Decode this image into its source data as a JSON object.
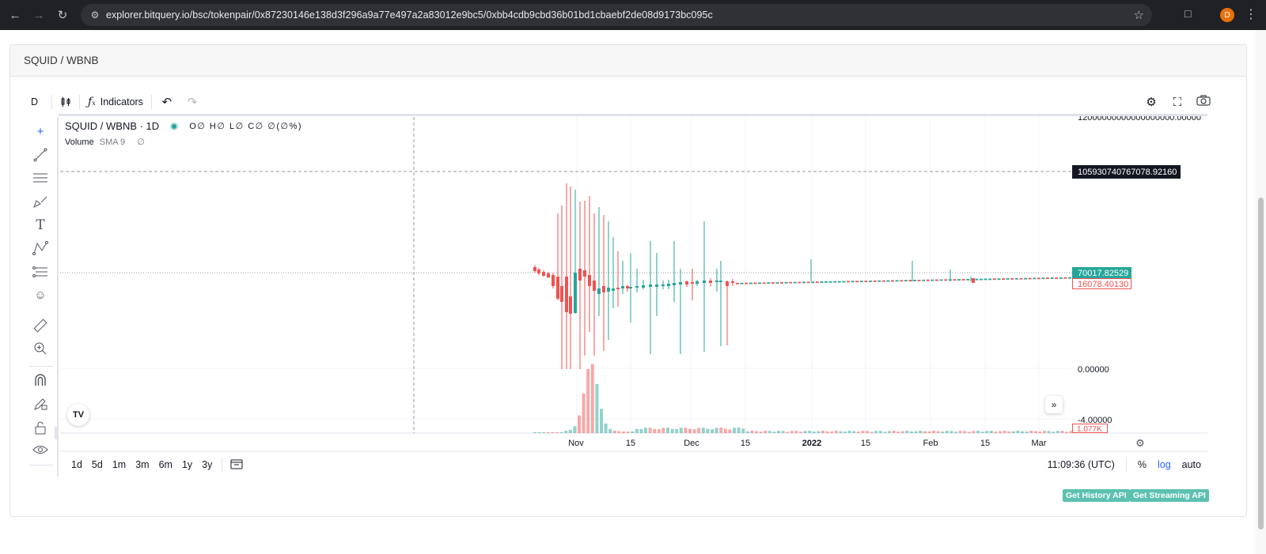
{
  "browser": {
    "url": "explorer.bitquery.io/bsc/tokenpair/0x87230146e138d3f296a9a77e497a2a83012e9bc5/0xbb4cdb9cbd36b01bd1cbaebf2de08d9173bc095c",
    "avatar_letter": "D"
  },
  "card": {
    "title": "SQUID / WBNB"
  },
  "toolbar": {
    "interval": "D",
    "indicators_label": "Indicators"
  },
  "legend": {
    "symbol": "SQUID / WBNB · 1D",
    "ohlc": "O∅ H∅ L∅ C∅ ∅(∅%)",
    "volume_label": "Volume",
    "volume_sma": "SMA 9",
    "volume_value": "∅"
  },
  "price_axis": {
    "top_label": "12000000000000000000.00000",
    "crosshair_label": "105930740767078.92160",
    "last_price_label": "70017.82529",
    "prev_price_label": "16078.40130",
    "zero_label": "0.00000",
    "neg_label": "-4.00000",
    "volume_label": "1.077K"
  },
  "time_axis": {
    "ticks": [
      "Nov",
      "15",
      "Dec",
      "15",
      "2022",
      "15",
      "Feb",
      "15",
      "Mar"
    ]
  },
  "range_buttons": [
    "1d",
    "5d",
    "1m",
    "3m",
    "6m",
    "1y",
    "3y"
  ],
  "bottom_right": {
    "time": "11:09:36 (UTC)",
    "percent": "%",
    "log": "log",
    "auto": "auto"
  },
  "api_buttons": {
    "history": "Get History API",
    "streaming": "Get Streaming API"
  },
  "colors": {
    "up": "#26a69a",
    "down": "#ef5350",
    "accent": "#2962ff",
    "api_button": "#5cc1b1"
  },
  "chart_data": {
    "type": "candlestick",
    "symbol": "SQUID / WBNB",
    "interval": "1D",
    "scale": "log",
    "x_ticks": [
      "Nov",
      "15",
      "Dec",
      "15",
      "2022",
      "15",
      "Feb",
      "15",
      "Mar"
    ],
    "last_price": 70017.82529,
    "previous_price": 16078.4013,
    "crosshair_price": 105930740767078.92,
    "volume_last": "1.077K"
  }
}
